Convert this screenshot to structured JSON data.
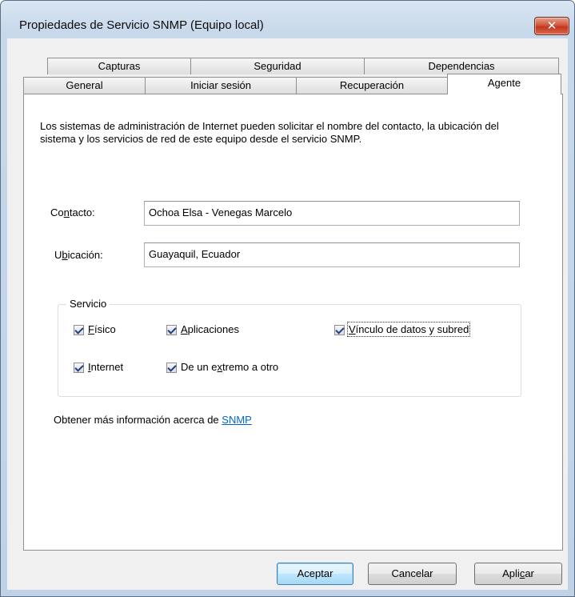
{
  "window": {
    "title": "Propiedades de Servicio SNMP (Equipo local)",
    "close_symbol": "✕",
    "close_icon": "close-icon"
  },
  "tabs": {
    "row_back": [
      {
        "label": "Capturas"
      },
      {
        "label": "Seguridad"
      },
      {
        "label": "Dependencias"
      }
    ],
    "row_front": [
      {
        "label": "General"
      },
      {
        "label": "Iniciar sesión"
      },
      {
        "label": "Recuperación"
      },
      {
        "label": "Agente",
        "selected": true
      }
    ]
  },
  "agent": {
    "description": "Los sistemas de administración de Internet pueden solicitar el nombre del contacto, la ubicación del sistema y los servicios de red de este equipo desde el servicio SNMP.",
    "contact": {
      "label_pre": "Co",
      "label_mnemonic": "n",
      "label_post": "tacto:",
      "value": "Ochoa Elsa - Venegas Marcelo"
    },
    "location": {
      "label_pre": "U",
      "label_mnemonic": "b",
      "label_post": "icación:",
      "value": "Guayaquil, Ecuador"
    },
    "service": {
      "legend": "Servicio",
      "items": [
        {
          "pre": "",
          "mnemonic": "F",
          "post": "ísico",
          "checked": true
        },
        {
          "pre": "",
          "mnemonic": "A",
          "post": "plicaciones",
          "checked": true
        },
        {
          "pre": "",
          "mnemonic": "V",
          "post": "ínculo de datos y subred",
          "checked": true
        },
        {
          "pre": "",
          "mnemonic": "I",
          "post": "nternet",
          "checked": true
        },
        {
          "pre": "De un e",
          "mnemonic": "x",
          "post": "tremo a otro",
          "checked": true
        }
      ]
    },
    "info_text": "Obtener más información acerca de ",
    "info_link": "SNMP"
  },
  "buttons": {
    "ok": "Aceptar",
    "cancel": "Cancelar",
    "apply_pre": "Apli",
    "apply_mnemonic": "c",
    "apply_post": "ar"
  }
}
